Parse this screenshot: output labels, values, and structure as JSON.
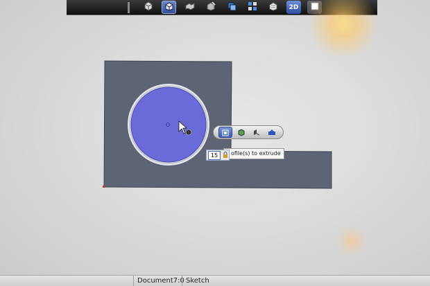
{
  "toolbar": {
    "buttons": [
      {
        "icon": "box-icon",
        "active": false
      },
      {
        "icon": "extrude-icon",
        "active": true
      },
      {
        "icon": "revolve-icon",
        "active": false
      },
      {
        "icon": "sweep-icon",
        "active": false
      },
      {
        "icon": "shell-icon",
        "active": false
      },
      {
        "icon": "pattern-icon",
        "active": false
      },
      {
        "icon": "combine-icon",
        "active": false
      },
      {
        "icon": "sketch-2d-icon",
        "label": "2D"
      },
      {
        "icon": "view-icon",
        "active": false
      }
    ]
  },
  "canvas": {
    "sketch_fill": "#5d6574",
    "circle_fill": "#6a6ad8",
    "circle_ring": "#d9d9dd"
  },
  "mini_toolbar": {
    "items": [
      "select-profile-icon",
      "extrude-body-icon",
      "push-pull-icon",
      "fill-icon"
    ]
  },
  "tooltip": {
    "text": "ofile(s) to extrude",
    "value": "15"
  },
  "statusbar": {
    "document": "Document7:0",
    "mode": "Sketch"
  }
}
